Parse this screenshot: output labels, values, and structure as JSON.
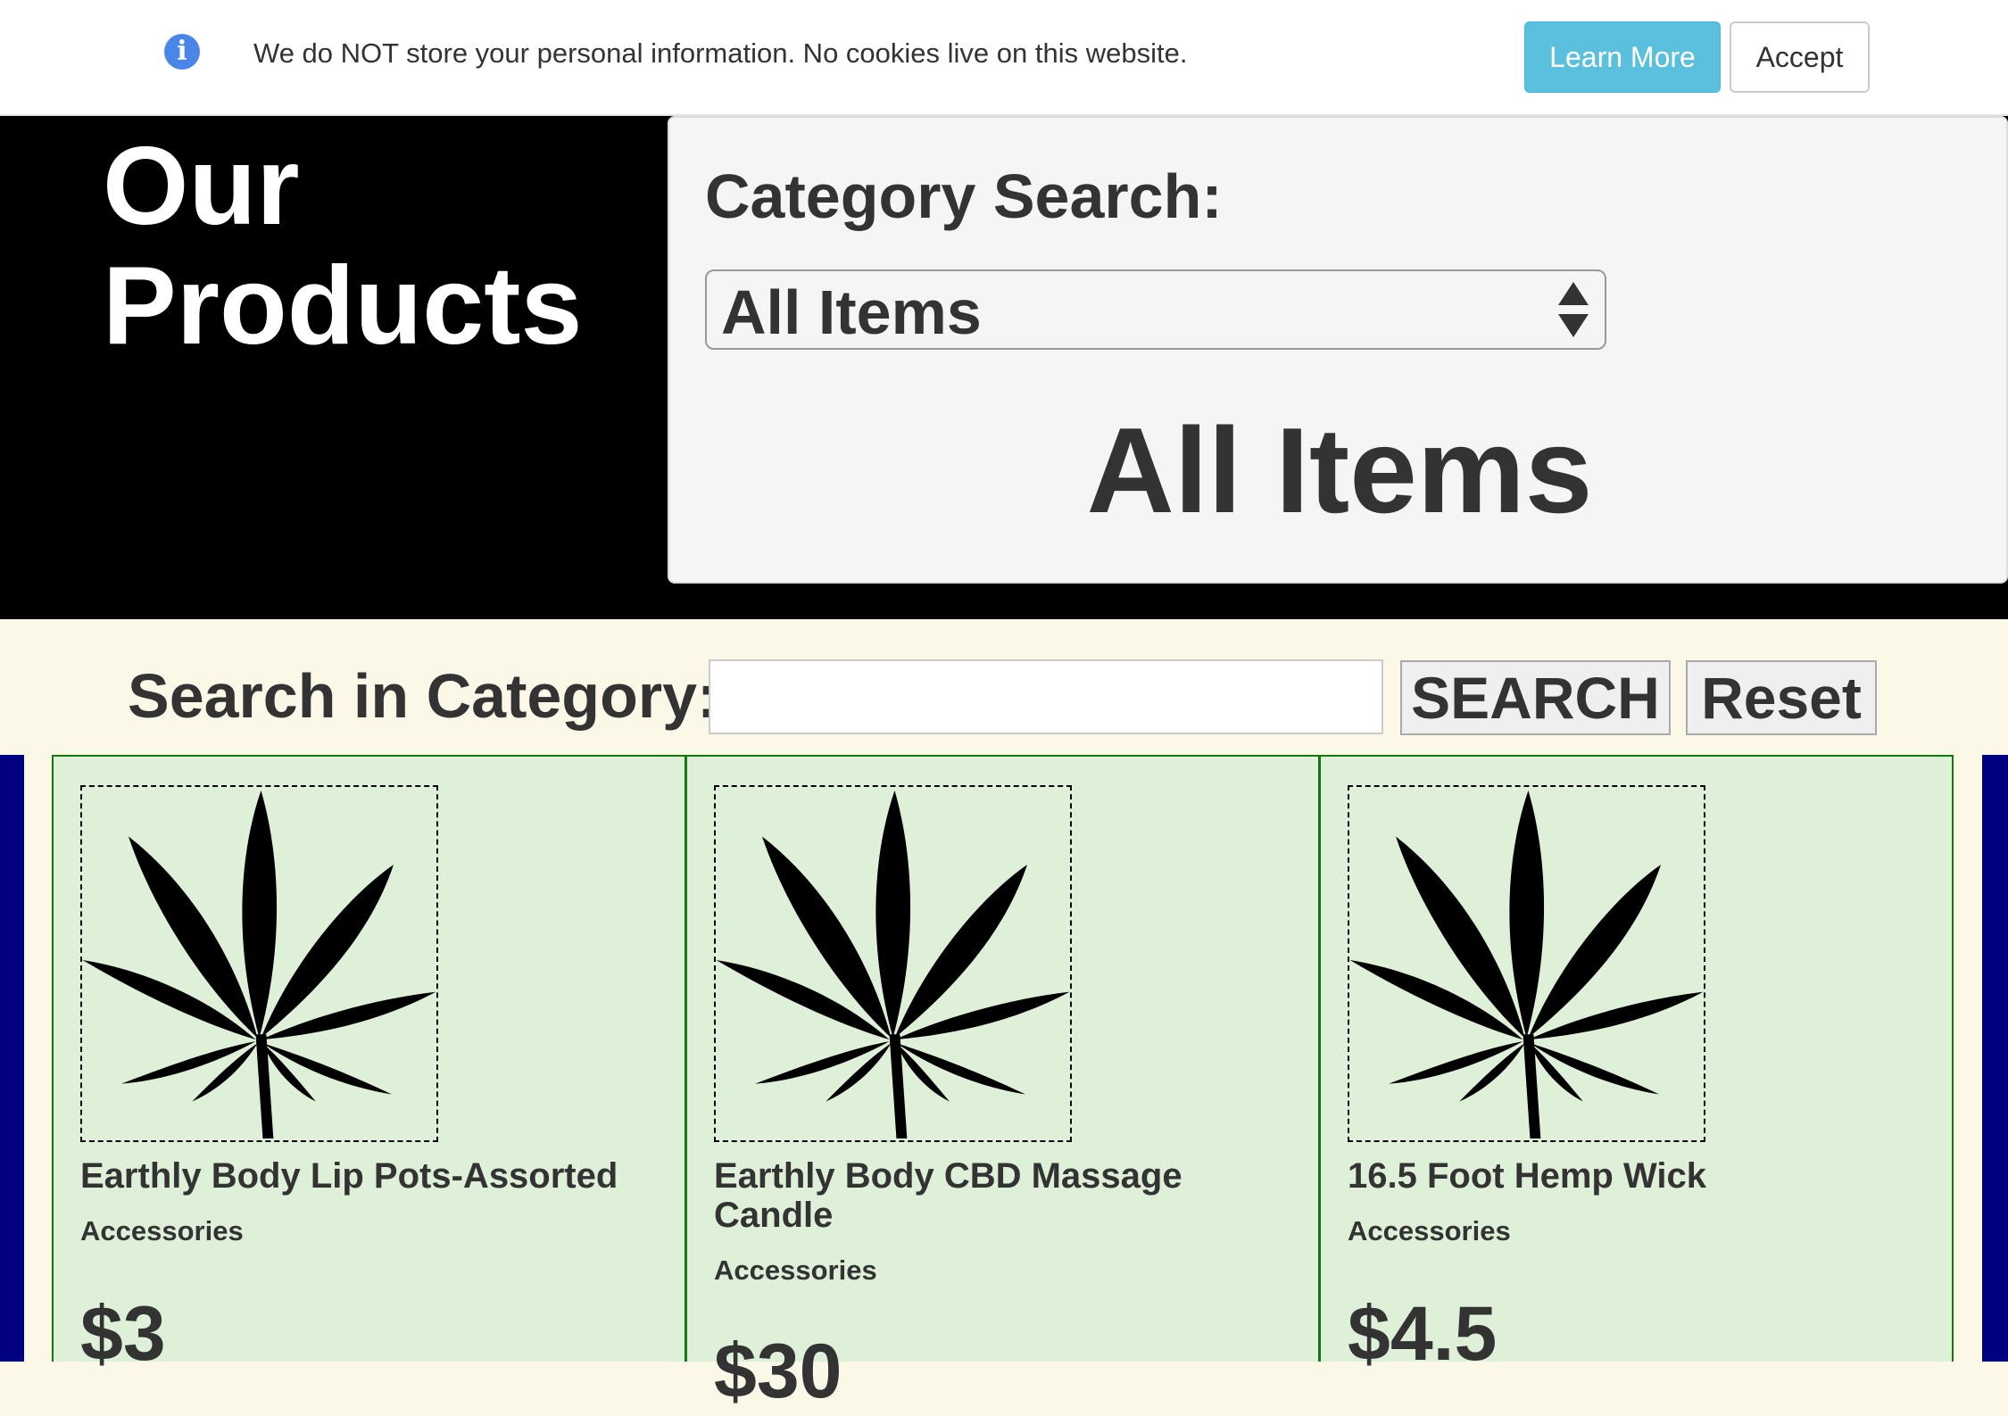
{
  "cookie_bar": {
    "icon": "info-icon",
    "message": "We do NOT store your personal information. No cookies live on this website.",
    "learn_more_label": "Learn More",
    "accept_label": "Accept",
    "learn_more_color": "#5bc0de"
  },
  "hero": {
    "title": "Our Products",
    "category_label": "Category Search:",
    "category_select_value": "All Items",
    "category_heading": "All Items"
  },
  "search": {
    "label": "Search in Category:",
    "input_value": "",
    "search_label": "SEARCH",
    "reset_label": "Reset"
  },
  "products": [
    {
      "name": "Earthly Body Lip Pots-Assorted",
      "category": "Accessories",
      "price": "$3",
      "image_icon": "cannabis-leaf-icon"
    },
    {
      "name": "Earthly Body CBD Massage Candle",
      "category": "Accessories",
      "price": "$30",
      "image_icon": "cannabis-leaf-icon"
    },
    {
      "name": "16.5 Foot Hemp Wick",
      "category": "Accessories",
      "price": "$4.5",
      "image_icon": "cannabis-leaf-icon"
    }
  ],
  "colors": {
    "hero_background": "#000000",
    "page_background": "#fcf8e8",
    "card_background": "#dff0d8",
    "card_border": "#117711",
    "side_bar": "#000080"
  }
}
